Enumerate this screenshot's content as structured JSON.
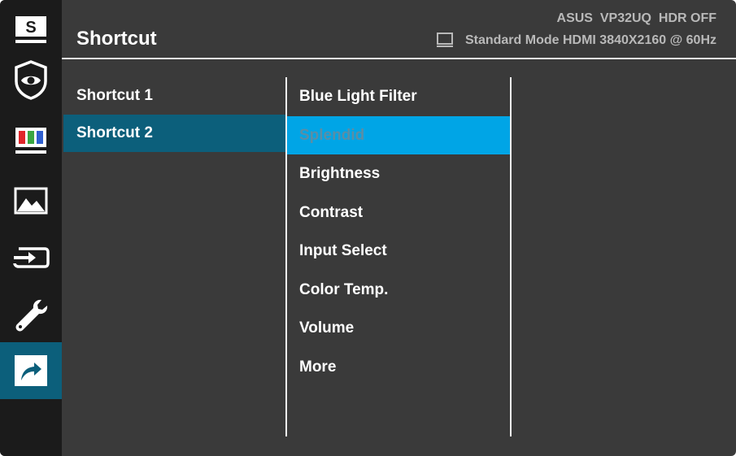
{
  "header": {
    "title": "Shortcut",
    "model_info": "ASUS  VP32UQ  HDR OFF",
    "mode_info": "Standard Mode HDMI 3840X2160 @ 60Hz"
  },
  "sidebar": {
    "items": [
      {
        "name": "splendid",
        "icon": "splendid-s-icon",
        "glyph": "S"
      },
      {
        "name": "blue-light-filter",
        "icon": "eye-shield-icon"
      },
      {
        "name": "color",
        "icon": "color-bars-icon"
      },
      {
        "name": "image",
        "icon": "image-mountain-icon"
      },
      {
        "name": "input-select",
        "icon": "input-arrow-icon"
      },
      {
        "name": "system-setup",
        "icon": "wrench-icon"
      },
      {
        "name": "shortcut",
        "icon": "shortcut-arrow-icon",
        "active": true
      }
    ]
  },
  "shortcut_list": [
    "Shortcut 1",
    "Shortcut 2"
  ],
  "selected_shortcut": "Shortcut 2",
  "functions": [
    "Blue Light Filter",
    "Splendid",
    "Brightness",
    "Contrast",
    "Input Select",
    "Color Temp.",
    "Volume",
    "More"
  ],
  "highlighted_function": "Splendid",
  "colors": {
    "background": "#3a3a3a",
    "sidebar": "#1b1b1b",
    "selection": "#0c5f7b",
    "highlight": "#00a5e6"
  }
}
